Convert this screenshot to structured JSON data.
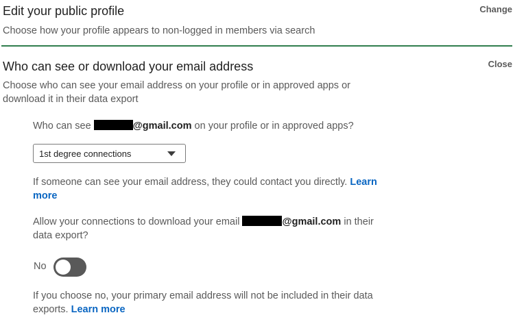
{
  "public_profile": {
    "title": "Edit your public profile",
    "description": "Choose how your profile appears to non-logged in members via search",
    "action_label": "Change"
  },
  "email_visibility": {
    "title": "Who can see or download your email address",
    "description": "Choose who can see your email address on your profile or in approved apps or download it in their data export",
    "action_label": "Close",
    "visibility_question": {
      "prefix": "Who can see",
      "email_domain": "@gmail.com",
      "suffix": "on your profile or in approved apps?"
    },
    "visibility_select": {
      "selected": "1st degree connections"
    },
    "visibility_help": {
      "text": "If someone can see your email address, they could contact you directly.",
      "link": "Learn more"
    },
    "download_question": {
      "prefix": "Allow your connections to download your email",
      "email_domain": "@gmail.com",
      "suffix": "in their data export?"
    },
    "download_toggle": {
      "label": "No",
      "on": false
    },
    "download_help": {
      "text": "If you choose no, your primary email address will not be included in their data exports.",
      "link": "Learn more"
    }
  },
  "colors": {
    "divider": "#2f7d4d",
    "link": "#0a66c2",
    "toggle_off": "#595959"
  }
}
